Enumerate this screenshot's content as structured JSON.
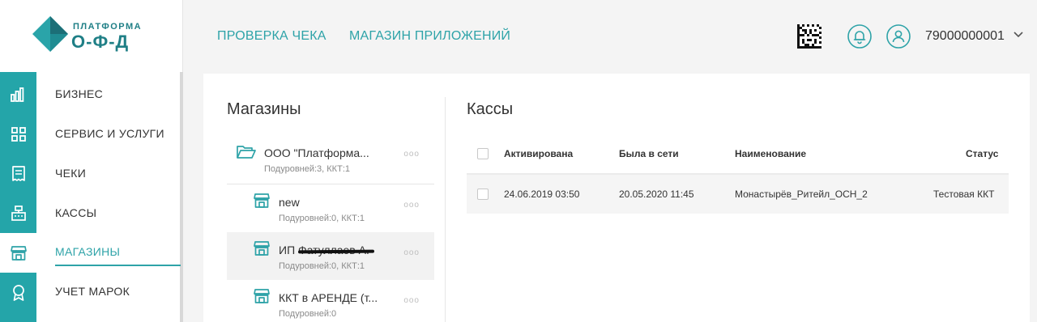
{
  "logo": {
    "line1": "ПЛАТФОРМА",
    "line2": "О-Ф-Д"
  },
  "header": {
    "nav": [
      {
        "label": "ПРОВЕРКА ЧЕКА"
      },
      {
        "label": "МАГАЗИН ПРИЛОЖЕНИЙ"
      }
    ],
    "user": "79000000001"
  },
  "sidebar": {
    "items": [
      {
        "label": "БИЗНЕС",
        "icon": "bar-chart-icon"
      },
      {
        "label": "СЕРВИС И УСЛУГИ",
        "icon": "grid-icon"
      },
      {
        "label": "ЧЕКИ",
        "icon": "receipt-icon"
      },
      {
        "label": "КАССЫ",
        "icon": "cash-register-icon"
      },
      {
        "label": "МАГАЗИНЫ",
        "icon": "store-icon",
        "active": true
      },
      {
        "label": "УЧЕТ МАРОК",
        "icon": "award-icon"
      }
    ]
  },
  "shops": {
    "title": "Магазины",
    "items": [
      {
        "name": "ООО \"Платформа...",
        "sub": "Подуровней:3, ККТ:1",
        "icon": "folder-open-icon"
      },
      {
        "name": "new",
        "sub": "Подуровней:0, ККТ:1",
        "icon": "store-icon"
      },
      {
        "name": "ИП Фатуллаев А.",
        "sub": "Подуровней:0, ККТ:1",
        "icon": "store-icon",
        "selected": true
      },
      {
        "name": "ККТ в АРЕНДЕ (т...",
        "sub": "Подуровней:0",
        "icon": "store-icon"
      }
    ],
    "more": "ooo"
  },
  "registers": {
    "title": "Кассы",
    "columns": [
      "Активирована",
      "Была в сети",
      "Наименование",
      "Статус"
    ],
    "rows": [
      {
        "activated": "24.06.2019 03:50",
        "online": "20.05.2020 11:45",
        "name": "Монастырёв_Ритейл_ОСН_2",
        "status": "Тестовая ККТ"
      }
    ]
  },
  "colors": {
    "accent": "#2ea3a8",
    "rail": "#24a5a9",
    "brand": "#1f7f86"
  }
}
